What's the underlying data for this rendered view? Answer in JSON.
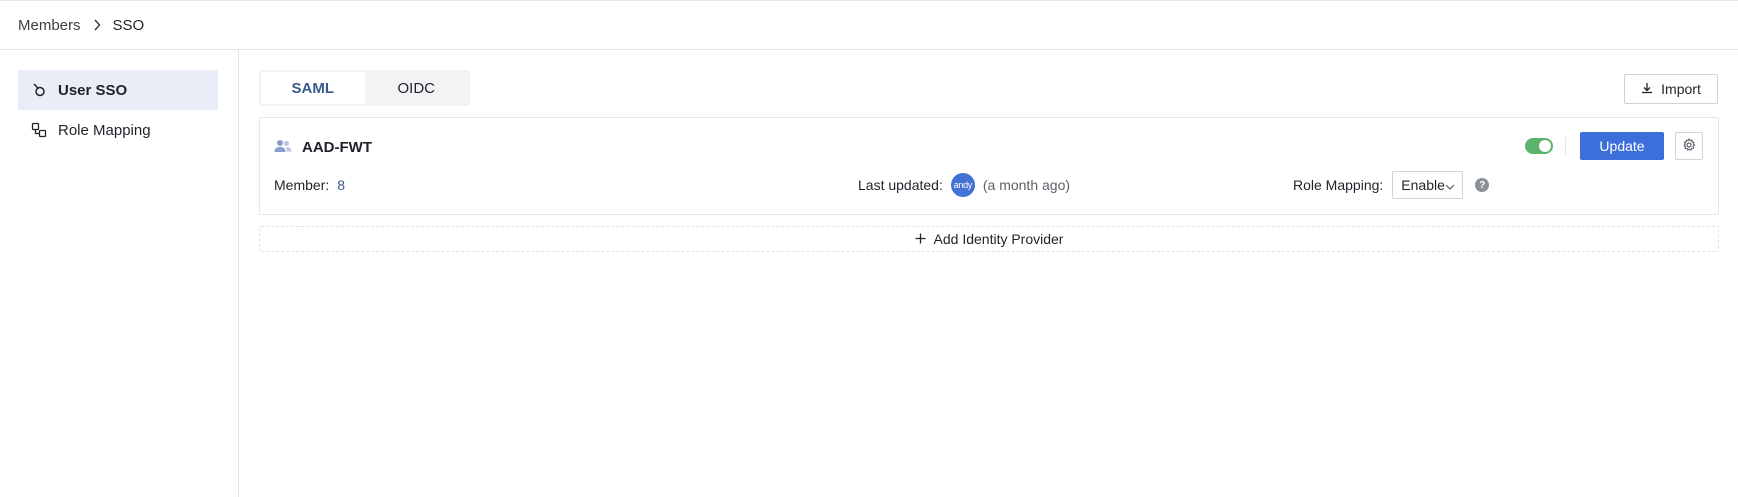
{
  "breadcrumb": {
    "parent": "Members",
    "current": "SSO"
  },
  "sidebar": {
    "items": [
      {
        "label": "User SSO",
        "icon": "user-sso-icon",
        "active": true
      },
      {
        "label": "Role Mapping",
        "icon": "role-mapping-icon",
        "active": false
      }
    ]
  },
  "tabs": [
    {
      "label": "SAML",
      "active": true
    },
    {
      "label": "OIDC",
      "active": false
    }
  ],
  "toolbar": {
    "import_label": "Import"
  },
  "provider": {
    "name": "AAD-FWT",
    "enabled": true,
    "update_label": "Update",
    "member_label": "Member:",
    "member_count": "8",
    "last_updated_label": "Last updated:",
    "avatar_text": "andy",
    "last_updated_relative": "(a month ago)",
    "role_mapping_label": "Role Mapping:",
    "role_mapping_value": "Enable",
    "help_glyph": "?"
  },
  "add_provider": {
    "label": "Add Identity Provider"
  },
  "colors": {
    "primary": "#3d6fdb",
    "toggle_on": "#5bb36b",
    "active_tab_text": "#3a5a8f",
    "sidebar_active_bg": "#e8edf8"
  }
}
